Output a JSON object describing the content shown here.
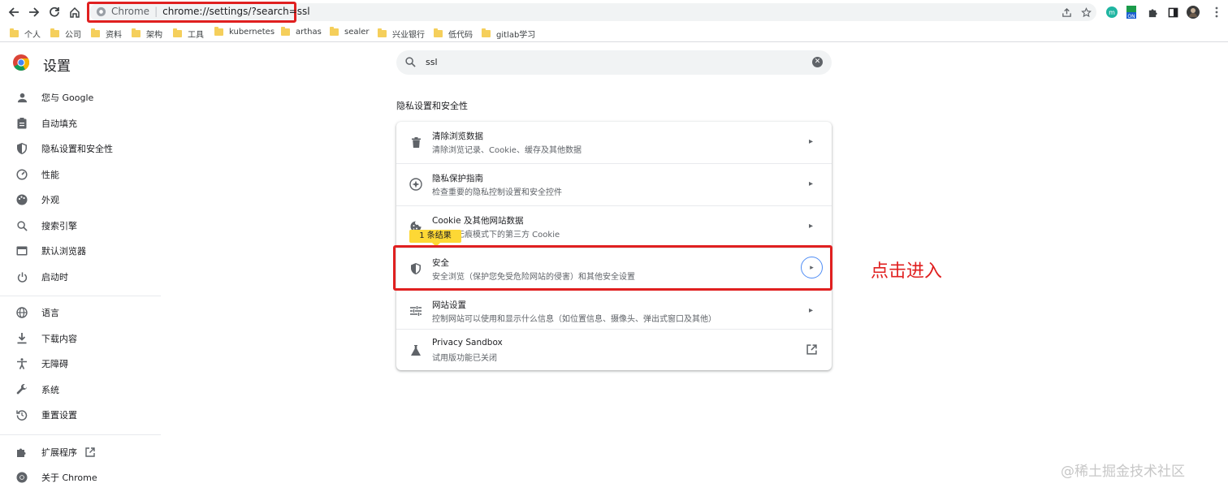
{
  "browser": {
    "omnibox_label": "Chrome",
    "url": "chrome://settings/?search=ssl"
  },
  "bookmarks": [
    {
      "label": "个人"
    },
    {
      "label": "公司"
    },
    {
      "label": "资料"
    },
    {
      "label": "架构"
    },
    {
      "label": "工具"
    },
    {
      "label": "kubernetes"
    },
    {
      "label": "arthas"
    },
    {
      "label": "sealer"
    },
    {
      "label": "兴业银行"
    },
    {
      "label": "低代码"
    },
    {
      "label": "gitlab学习"
    }
  ],
  "sidebar": {
    "title": "设置",
    "items": [
      {
        "label": "您与 Google",
        "icon": "person-icon"
      },
      {
        "label": "自动填充",
        "icon": "clipboard-icon"
      },
      {
        "label": "隐私设置和安全性",
        "icon": "shield-icon"
      },
      {
        "label": "性能",
        "icon": "speedometer-icon"
      },
      {
        "label": "外观",
        "icon": "palette-icon"
      },
      {
        "label": "搜索引擎",
        "icon": "search-icon"
      },
      {
        "label": "默认浏览器",
        "icon": "browser-icon"
      },
      {
        "label": "启动时",
        "icon": "power-icon"
      },
      {
        "label": "语言",
        "icon": "globe-icon"
      },
      {
        "label": "下载内容",
        "icon": "download-icon"
      },
      {
        "label": "无障碍",
        "icon": "accessibility-icon"
      },
      {
        "label": "系统",
        "icon": "wrench-icon"
      },
      {
        "label": "重置设置",
        "icon": "reset-icon"
      },
      {
        "label": "扩展程序",
        "icon": "puzzle-icon"
      },
      {
        "label": "关于 Chrome",
        "icon": "chrome-icon"
      }
    ]
  },
  "search": {
    "value": "ssl"
  },
  "section": {
    "title": "隐私设置和安全性"
  },
  "rows": [
    {
      "title": "清除浏览数据",
      "subtitle": "清除浏览记录、Cookie、缓存及其他数据",
      "icon": "trash-icon"
    },
    {
      "title": "隐私保护指南",
      "subtitle": "检查重要的隐私控制设置和安全控件",
      "icon": "privacy-guide-icon"
    },
    {
      "title": "Cookie 及其他网站数据",
      "subtitle": "已阻止无痕模式下的第三方 Cookie",
      "icon": "cookie-icon"
    },
    {
      "title": "安全",
      "subtitle": "安全浏览（保护您免受危险网站的侵害）和其他安全设置",
      "icon": "security-shield-icon"
    },
    {
      "title": "网站设置",
      "subtitle": "控制网站可以使用和显示什么信息（如位置信息、摄像头、弹出式窗口及其他）",
      "icon": "tune-icon"
    },
    {
      "title": "Privacy Sandbox",
      "subtitle": "试用版功能已关闭",
      "icon": "flask-icon"
    }
  ],
  "results_badge": "1 条结果",
  "annotation": "点击进入",
  "watermark": "@稀土掘金技术社区",
  "colors": {
    "highlight": "#e02020",
    "badge": "#fdd835",
    "focus_ring": "#4f8df5"
  }
}
